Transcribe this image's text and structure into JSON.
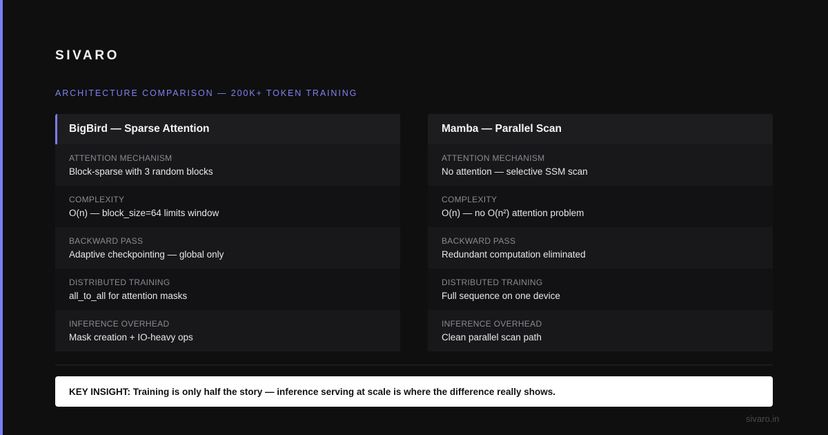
{
  "brand": "SIVARO",
  "subtitle": "ARCHITECTURE COMPARISON — 200K+ TOKEN TRAINING",
  "accent_color": "#7b7ef5",
  "cards": [
    {
      "title": "BigBird — Sparse Attention",
      "rows": [
        {
          "label": "ATTENTION MECHANISM",
          "value": "Block-sparse with 3 random blocks"
        },
        {
          "label": "COMPLEXITY",
          "value": "O(n) — block_size=64 limits window"
        },
        {
          "label": "BACKWARD PASS",
          "value": "Adaptive checkpointing — global only"
        },
        {
          "label": "DISTRIBUTED TRAINING",
          "value": "all_to_all for attention masks"
        },
        {
          "label": "INFERENCE OVERHEAD",
          "value": "Mask creation + IO-heavy ops"
        }
      ]
    },
    {
      "title": "Mamba — Parallel Scan",
      "rows": [
        {
          "label": "ATTENTION MECHANISM",
          "value": "No attention — selective SSM scan"
        },
        {
          "label": "COMPLEXITY",
          "value": "O(n) — no O(n²) attention problem"
        },
        {
          "label": "BACKWARD PASS",
          "value": "Redundant computation eliminated"
        },
        {
          "label": "DISTRIBUTED TRAINING",
          "value": "Full sequence on one device"
        },
        {
          "label": "INFERENCE OVERHEAD",
          "value": "Clean parallel scan path"
        }
      ]
    }
  ],
  "insight": "KEY INSIGHT: Training is only half the story — inference serving at scale is where the difference really shows.",
  "site": "sivaro.in"
}
